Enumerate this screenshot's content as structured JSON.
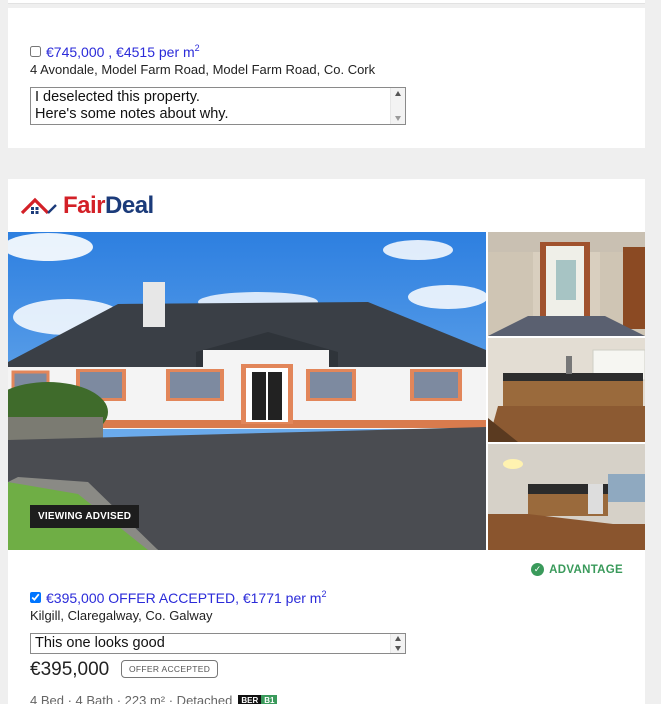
{
  "listing1": {
    "checked": false,
    "price_link": "€745,000 , €4515 per m",
    "price_sup": "2",
    "address": "4 Avondale, Model Farm Road, Model Farm Road, Co. Cork",
    "notes_line1": "I deselected this property.",
    "notes_line2": "Here's some notes about why."
  },
  "listing2": {
    "agent_logo_part1": "Fair",
    "agent_logo_part2": "Deal",
    "badge": "VIEWING ADVISED",
    "advantage_label": "ADVANTAGE",
    "checked": true,
    "price_link": "€395,000 OFFER ACCEPTED, €1771 per m",
    "price_sup": "2",
    "address": "Kilgill, Claregalway, Co. Galway",
    "notes": "This one looks good",
    "price": "€395,000",
    "status": "OFFER ACCEPTED",
    "specs": "4 Bed · 4 Bath · 223 m² · Detached",
    "ber_label": "BER",
    "ber_grade": "B1"
  },
  "colors": {
    "link": "#2b2bd9",
    "brand_red": "#d32027",
    "brand_blue": "#1b3b7a",
    "advantage_green": "#3a9a5b"
  }
}
